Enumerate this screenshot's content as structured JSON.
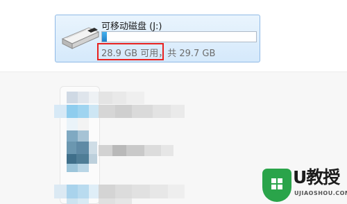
{
  "drive": {
    "name": "可移动磁盘 (J:)",
    "free_text": "28.9 GB 可用",
    "total_text": "，共 29.7 GB",
    "used_fraction": 0.03,
    "icon": "usb-drive-icon"
  },
  "highlight": {
    "color": "#e8211f"
  },
  "watermark": {
    "title": "U教授",
    "url": "UJIAOSHOU.COM",
    "icon": "shield-windows-logo-icon",
    "color": "#2aa44a"
  }
}
